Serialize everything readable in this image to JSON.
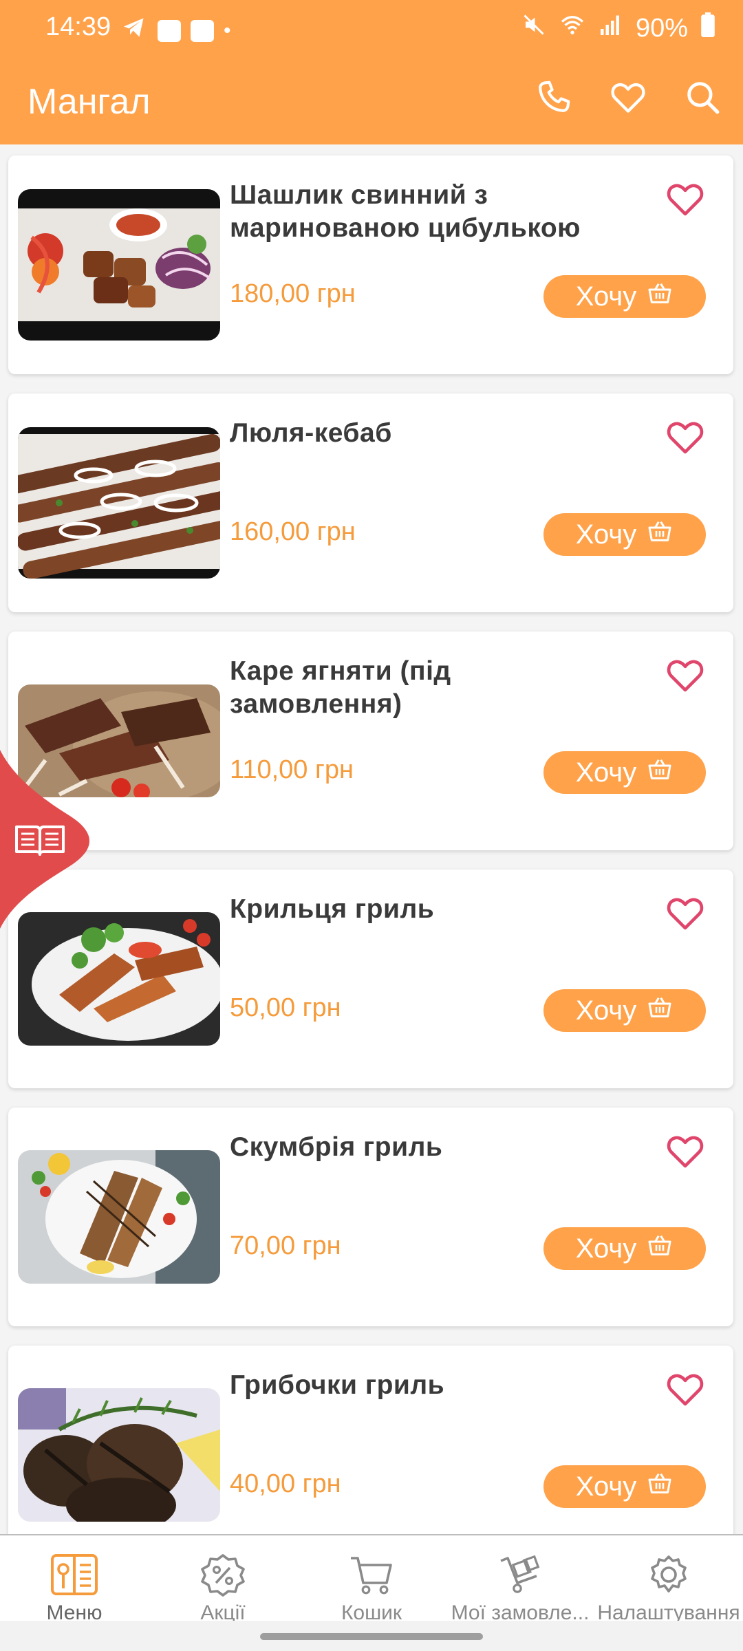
{
  "status": {
    "time": "14:39",
    "battery": "90%"
  },
  "appbar": {
    "title": "Мангал",
    "icons": [
      "phone-icon",
      "heart-icon",
      "search-icon"
    ]
  },
  "buy_label": "Хочу",
  "products": [
    {
      "title": "Шашлик свинний з маринованою цибулькою",
      "price": "180,00 грн"
    },
    {
      "title": "Люля-кебаб",
      "price": "160,00 грн"
    },
    {
      "title": "Каре ягняти (під замовлення)",
      "price": "110,00 грн"
    },
    {
      "title": "Крильця гриль",
      "price": "50,00 грн"
    },
    {
      "title": "Скумбрія гриль",
      "price": "70,00 грн"
    },
    {
      "title": "Грибочки гриль",
      "price": "40,00 грн"
    }
  ],
  "nav": [
    {
      "label": "Меню",
      "icon": "menu-book-icon"
    },
    {
      "label": "Акції",
      "icon": "discount-icon"
    },
    {
      "label": "Кошик",
      "icon": "cart-icon"
    },
    {
      "label": "Мої замовле...",
      "icon": "orders-cart-icon"
    },
    {
      "label": "Налаштування",
      "icon": "gear-icon"
    }
  ],
  "colors": {
    "accent": "#FFA24A",
    "price": "#F59B3B",
    "heart": "#E0466B",
    "side_tab": "#E24B4B"
  }
}
